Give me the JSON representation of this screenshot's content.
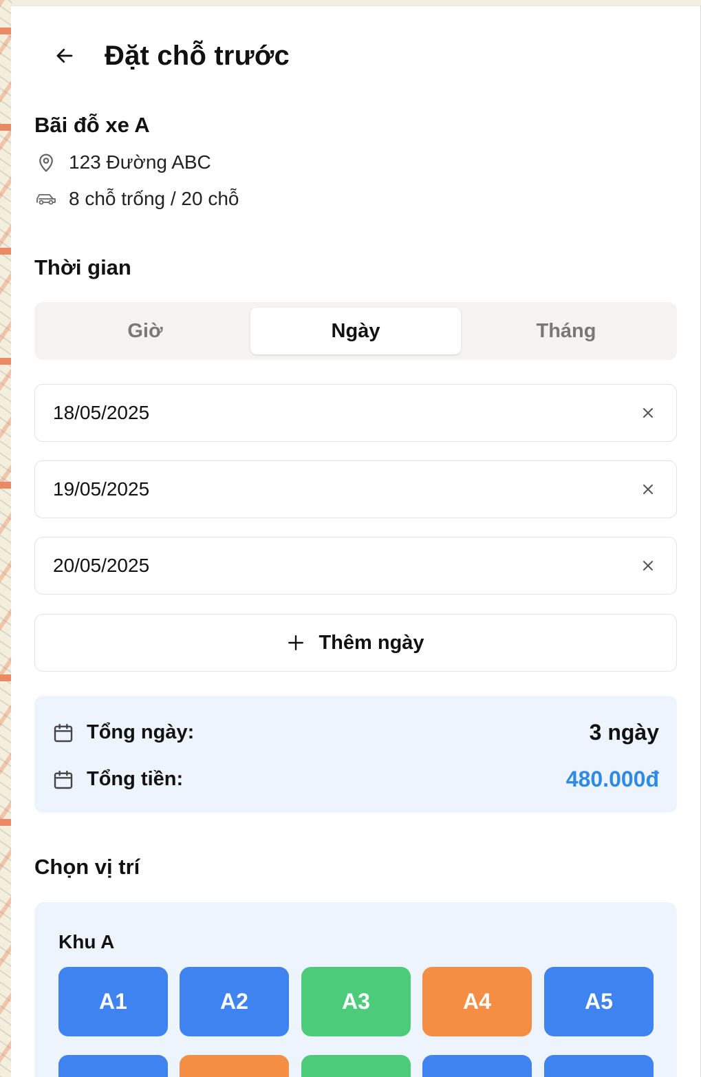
{
  "header": {
    "title": "Đặt chỗ trước"
  },
  "lot": {
    "name": "Bãi đỗ xe A",
    "address": "123 Đường ABC",
    "availability": "8 chỗ trống / 20 chỗ"
  },
  "time": {
    "section_title": "Thời gian",
    "tabs": [
      {
        "label": "Giờ",
        "active": false
      },
      {
        "label": "Ngày",
        "active": true
      },
      {
        "label": "Tháng",
        "active": false
      }
    ],
    "dates": [
      "18/05/2025",
      "19/05/2025",
      "20/05/2025"
    ],
    "add_day_label": "Thêm ngày"
  },
  "summary": {
    "total_days_label": "Tổng ngày:",
    "total_days_value": "3 ngày",
    "total_price_label": "Tổng tiền:",
    "total_price_value": "480.000đ",
    "price_color": "#2f8ae5"
  },
  "position": {
    "section_title": "Chọn vị trí",
    "zone_name": "Khu A",
    "slots": [
      {
        "label": "A1",
        "status": "blue"
      },
      {
        "label": "A2",
        "status": "blue"
      },
      {
        "label": "A3",
        "status": "green"
      },
      {
        "label": "A4",
        "status": "orange"
      },
      {
        "label": "A5",
        "status": "blue"
      }
    ],
    "second_row_status": [
      "blue",
      "orange",
      "green",
      "blue",
      "blue"
    ],
    "colors": {
      "blue": "#3f83f0",
      "green": "#4ccc7a",
      "orange": "#f58e45"
    }
  }
}
